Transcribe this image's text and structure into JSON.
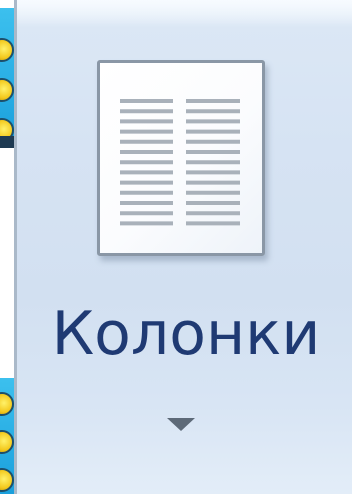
{
  "ribbon_button": {
    "label": "Колонки",
    "icon": "columns-document-icon",
    "dropdown_icon": "dropdown-arrow-icon",
    "has_dropdown": true
  },
  "colors": {
    "ribbon_background": "#d6e3f3",
    "label_text": "#1f3a73",
    "icon_border": "#8a97a6",
    "text_lines": "#a9b1ba",
    "dropdown_arrow": "#5d6a78",
    "neighbor_icon_blue": "#1a9fdc",
    "neighbor_icon_yellow": "#f3c81c"
  },
  "neighbors": {
    "left_icons": [
      "partial-ribbon-icon",
      "partial-ribbon-icon"
    ]
  }
}
